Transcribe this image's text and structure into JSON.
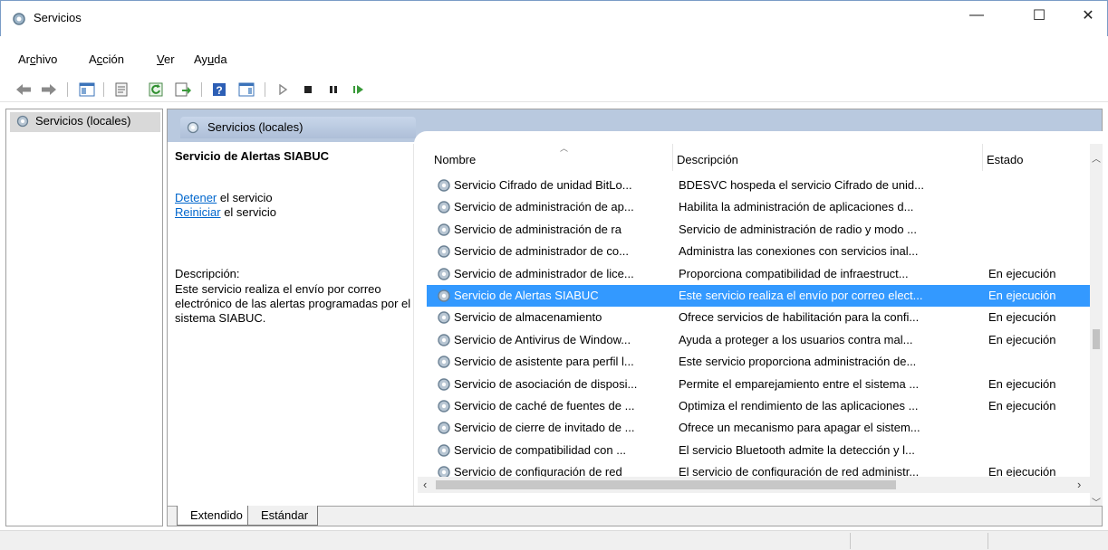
{
  "window": {
    "title": "Servicios"
  },
  "menu": [
    {
      "pre": "Ar",
      "u": "c",
      "post": "hivo"
    },
    {
      "pre": "A",
      "u": "c",
      "post": "ción"
    },
    {
      "pre": "",
      "u": "V",
      "post": "er"
    },
    {
      "pre": "Ay",
      "u": "u",
      "post": "da"
    }
  ],
  "tree": {
    "root_label": "Servicios (locales)"
  },
  "panel": {
    "header_title": "Servicios (locales)",
    "selected_service": "Servicio de Alertas SIABUC",
    "actions": [
      {
        "link": "Detener",
        "text": " el servicio"
      },
      {
        "link": "Reiniciar",
        "text": " el servicio"
      }
    ],
    "description_label": "Descripción:",
    "description_text": "Este servicio realiza el envío por correo electrónico de las alertas programadas por el sistema SIABUC."
  },
  "columns": [
    "Nombre",
    "Descripción",
    "Estado"
  ],
  "rows": [
    {
      "name": "Servicio Cifrado de unidad BitLo...",
      "desc": "BDESVC hospeda el servicio Cifrado de unid...",
      "state": ""
    },
    {
      "name": "Servicio de administración de ap...",
      "desc": "Habilita la administración de aplicaciones d...",
      "state": ""
    },
    {
      "name": "Servicio de administración de ra",
      "desc": "Servicio de administración de radio y modo ...",
      "state": ""
    },
    {
      "name": "Servicio de administrador de co...",
      "desc": "Administra las conexiones con servicios inal...",
      "state": ""
    },
    {
      "name": "Servicio de administrador de lice...",
      "desc": "Proporciona compatibilidad de infraestruct...",
      "state": "En ejecución"
    },
    {
      "name": "Servicio de Alertas SIABUC",
      "desc": "Este servicio realiza el envío por correo elect...",
      "state": "En ejecución",
      "selected": true
    },
    {
      "name": "Servicio de almacenamiento",
      "desc": "Ofrece servicios de habilitación para la confi...",
      "state": "En ejecución"
    },
    {
      "name": "Servicio de Antivirus de Window...",
      "desc": "Ayuda a proteger a los usuarios contra mal...",
      "state": "En ejecución"
    },
    {
      "name": "Servicio de asistente para perfil l...",
      "desc": "Este servicio proporciona administración de...",
      "state": ""
    },
    {
      "name": "Servicio de asociación de disposi...",
      "desc": "Permite el emparejamiento entre el sistema ...",
      "state": "En ejecución"
    },
    {
      "name": "Servicio de caché de fuentes de ...",
      "desc": "Optimiza el rendimiento de las aplicaciones ...",
      "state": "En ejecución"
    },
    {
      "name": "Servicio de cierre de invitado de ...",
      "desc": "Ofrece un mecanismo para apagar el sistem...",
      "state": ""
    },
    {
      "name": "Servicio de compatibilidad con ...",
      "desc": "El servicio Bluetooth admite la detección y l...",
      "state": ""
    },
    {
      "name": "Servicio de configuración de red",
      "desc": "El servicio de configuración de red administr...",
      "state": "En ejecución"
    }
  ],
  "tabs": [
    "Extendido",
    "Estándar"
  ],
  "colors": {
    "selection": "#3399ff",
    "header_band": "#b9c9df",
    "link": "#0066cc"
  }
}
